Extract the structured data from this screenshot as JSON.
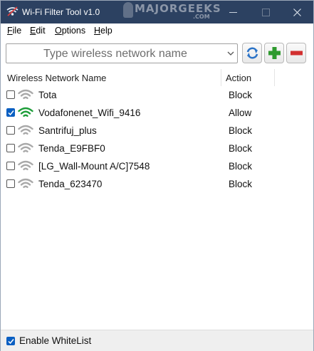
{
  "window": {
    "title": "Wi-Fi Filter Tool v1.0",
    "watermark_text": "MAJORGEEKS",
    "watermark_sub": ".COM"
  },
  "menu": [
    {
      "label": "File",
      "mnemonic": "F",
      "rest": "ile"
    },
    {
      "label": "Edit",
      "mnemonic": "E",
      "rest": "dit"
    },
    {
      "label": "Options",
      "mnemonic": "O",
      "rest": "ptions"
    },
    {
      "label": "Help",
      "mnemonic": "H",
      "rest": "elp"
    }
  ],
  "toolbar": {
    "network_input_placeholder": "Type wireless network name",
    "refresh_icon": "refresh-icon",
    "add_icon": "plus-icon",
    "remove_icon": "minus-icon"
  },
  "list": {
    "columns": [
      "Wireless Network Name",
      "Action"
    ],
    "rows": [
      {
        "checked": false,
        "name": "Tota",
        "action": "Block",
        "signal_color": "#a9a9a9"
      },
      {
        "checked": true,
        "name": "Vodafonenet_Wifi_9416",
        "action": "Allow",
        "signal_color": "#1e9e3a"
      },
      {
        "checked": false,
        "name": "Santrifuj_plus",
        "action": "Block",
        "signal_color": "#a9a9a9"
      },
      {
        "checked": false,
        "name": "Tenda_E9FBF0",
        "action": "Block",
        "signal_color": "#a9a9a9"
      },
      {
        "checked": false,
        "name": "[LG_Wall-Mount A/C]7548",
        "action": "Block",
        "signal_color": "#a9a9a9"
      },
      {
        "checked": false,
        "name": "Tenda_623470",
        "action": "Block",
        "signal_color": "#a9a9a9"
      }
    ]
  },
  "footer": {
    "enable_whitelist_label": "Enable WhiteList",
    "enable_whitelist_checked": true
  },
  "colors": {
    "titlebar": "#2c4161",
    "checkbox_checked": "#0a5fc2",
    "add_green": "#2e9a2e",
    "remove_red": "#d23030",
    "refresh_blue": "#2b73c7"
  }
}
